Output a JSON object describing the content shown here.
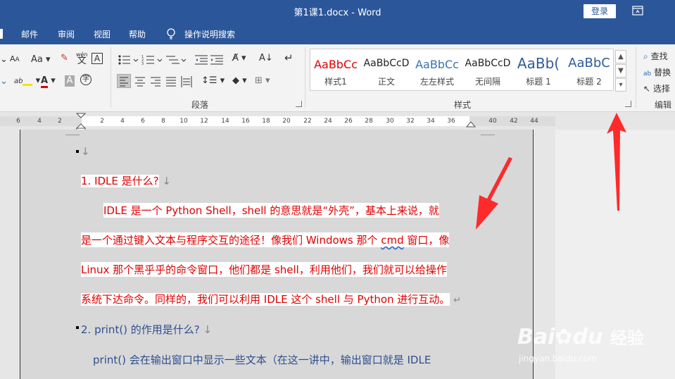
{
  "window": {
    "title": "第1课1.docx  -  Word",
    "login_label": "登录"
  },
  "tabs": [
    "邮件",
    "审阅",
    "视图",
    "帮助"
  ],
  "tell_me": "操作说明搜索",
  "ribbon": {
    "font_aa": "Aa",
    "wen": "wén",
    "wen_char": "文",
    "A_box": "A",
    "groups": {
      "paragraph": "段落",
      "styles": "样式",
      "editing": "编辑"
    },
    "styles": [
      {
        "sample": "AaBbCc",
        "name": "样式1",
        "color": "#e00000"
      },
      {
        "sample": "AaBbCcD",
        "name": "正文",
        "color": "#222222"
      },
      {
        "sample": "AaBbCc",
        "name": "左左样式",
        "color": "#3d6fb6"
      },
      {
        "sample": "AaBbCcD",
        "name": "无间隔",
        "color": "#222222"
      },
      {
        "sample": "AaBb(",
        "name": "标题 1",
        "color": "#2e5c99"
      },
      {
        "sample": "AaBbC",
        "name": "标题 2",
        "color": "#2e5c99"
      }
    ],
    "editing": {
      "find": "查找",
      "replace": "替换",
      "select": "选择"
    }
  },
  "ruler": {
    "ticks": [
      "6",
      "4",
      "2",
      "2",
      "4",
      "6",
      "8",
      "10",
      "12",
      "14",
      "16",
      "18",
      "20",
      "22",
      "24",
      "26",
      "28",
      "30",
      "32",
      "34",
      "36",
      "40",
      "42",
      "44"
    ]
  },
  "document": {
    "para_mark": "↓",
    "h1": "1. IDLE  是什么?",
    "p1_lines": [
      "IDLE 是一个 Python Shell，shell 的意思就是“外壳”，基本上来说，就",
      "是一个通过键入文本与程序交互的途径！像我们 Windows 那个 ",
      "Linux 那个黑乎乎的命令窗口，他们都是 shell，利用他们，我们就可以给操作",
      "系统下达命令。同样的，我们可以利用 IDLE 这个 shell 与 Python 进行互动。"
    ],
    "cmd_word": "cmd",
    "line2_tail": " 窗口，像",
    "return_mark": "↵",
    "h2": "2. print()  的作用是什么?",
    "p2_line": "print()  会在输出窗口中显示一些文本（在这一讲中，输出窗口就是 IDLE"
  },
  "watermark": {
    "brand": "Bai",
    "brand2": "du",
    "cn": "经验",
    "url": "jingyan.baidu.com"
  },
  "colors": {
    "titlebar": "#2b579a",
    "arrow": "#ff2a2a",
    "doc_red": "#e00000",
    "doc_blue": "#2f4f8f"
  }
}
